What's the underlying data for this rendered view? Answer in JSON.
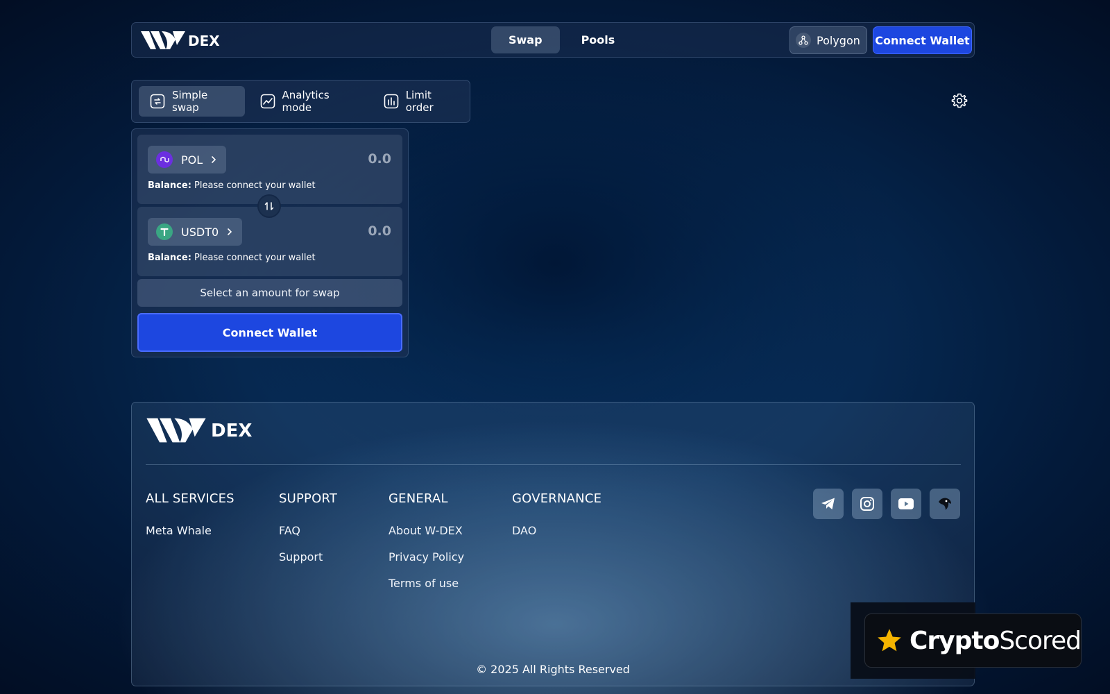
{
  "brand": {
    "name": "DEX"
  },
  "nav": {
    "tabs": [
      {
        "label": "Swap",
        "active": true
      },
      {
        "label": "Pools",
        "active": false
      }
    ]
  },
  "network": {
    "label": "Polygon",
    "icon": "network-icon"
  },
  "header": {
    "connect_label": "Connect Wallet"
  },
  "modes": [
    {
      "label": "Simple swap",
      "icon": "swap-mode-icon",
      "active": true
    },
    {
      "label": "Analytics mode",
      "icon": "chart-icon",
      "active": false
    },
    {
      "label": "Limit order",
      "icon": "limit-order-icon",
      "active": false
    }
  ],
  "swap": {
    "from": {
      "token": "POL",
      "placeholder": "0.0",
      "balance_label": "Balance:",
      "balance_value": "Please connect your wallet"
    },
    "to": {
      "token": "USDT0",
      "placeholder": "0.0",
      "balance_label": "Balance:",
      "balance_value": "Please connect your wallet"
    },
    "select_amount": "Select an amount for swap",
    "connect_label": "Connect Wallet"
  },
  "footer": {
    "columns": [
      {
        "title": "ALL SERVICES",
        "links": [
          "Meta Whale"
        ]
      },
      {
        "title": "SUPPORT",
        "links": [
          "FAQ",
          "Support"
        ]
      },
      {
        "title": "GENERAL",
        "links": [
          "About W-DEX",
          "Privacy Policy",
          "Terms of use"
        ]
      },
      {
        "title": "GOVERNANCE",
        "links": [
          "DAO"
        ]
      }
    ],
    "socials": [
      "telegram-icon",
      "instagram-icon",
      "youtube-icon",
      "bird-icon"
    ],
    "copyright": "© 2025 All Rights Reserved"
  },
  "badge": {
    "prefix": "Crypto",
    "suffix": "Scored"
  },
  "colors": {
    "accent": "#1d47e0",
    "pol": "#6b2fe0",
    "usdt": "#3aa683",
    "star": "#f5b400"
  }
}
